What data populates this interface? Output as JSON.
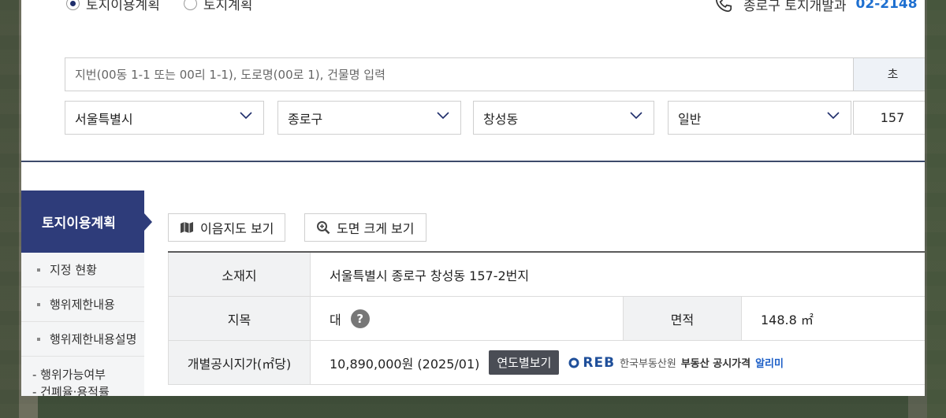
{
  "radio": {
    "options": [
      "토지이용계획",
      "토지계획"
    ]
  },
  "contact": {
    "label": "종로구 토지개발과",
    "phone": "02-2148"
  },
  "search": {
    "placeholder": "지번(00동 1-1 또는 00리 1-1), 도로명(00로 1), 건물명 입력",
    "button_label": "초"
  },
  "selects": {
    "city": "서울특별시",
    "district": "종로구",
    "dong": "창성동",
    "type": "일반",
    "lot": "157"
  },
  "sidebar": {
    "title": "토지이용계획",
    "items": [
      "지정 현황",
      "행위제한내용",
      "행위제한내용설명"
    ],
    "sub": [
      "- 행위가능여부",
      "- 건폐율·용적률"
    ]
  },
  "buttons": {
    "map": "이음지도 보기",
    "zoom": "도면 크게 보기"
  },
  "table": {
    "location_label": "소재지",
    "location_value": "서울특별시 종로구 창성동 157-2번지",
    "category_label": "지목",
    "category_value": "대",
    "help_symbol": "?",
    "area_label": "면적",
    "area_value": "148.8 ㎡",
    "price_label": "개별공시지가(㎡당)",
    "price_value": "10,890,000원 (2025/01)",
    "yearly_button": "연도별보기",
    "reb_logo": "REB",
    "reb_org": "한국부동산원",
    "reb_service": "부동산 공시가격",
    "reb_app": "알리미"
  },
  "colors": {
    "nav": "#2e3c7a",
    "divider": "#3d4a6b",
    "accent": "#1d6fd0"
  }
}
